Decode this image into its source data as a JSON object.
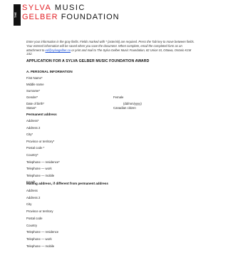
{
  "logo": {
    "side_text": "THE",
    "line1_red": "SYLVA",
    "line1_black": "MUSIC",
    "line2_red": "GELBER",
    "line2_black": "FOUNDATION",
    "line3": ""
  },
  "intro": {
    "text_before_link": "Enter your information in the gray fields. Fields marked with * (asterisk) are required. Press the Tab key to move between fields. Your entered information will be saved when you save the document. When complete, email the completed form as an attachment to ",
    "link": "ed@sylvagelber.ca",
    "text_after_link": " or print and mail to The Sylva Gelber Music Foundation, 82 Union St, Ottawa, Ontario K1M 1S2."
  },
  "title": "APPLICATION FOR A SYLVA GELBER MUSIC FOUNDATION AWARD",
  "personal": {
    "heading": "A. PERSONAL INFORMATION",
    "first_name": "First Name*",
    "middle_name": "Middle name",
    "surname": "Surname*",
    "gender": "Gender*",
    "gender_value": "Female",
    "dob": "Date of birth*",
    "dob_format": "(dd/mm/yyyy)",
    "status": "Status*",
    "status_value": "Canadian citizen"
  },
  "permanent": {
    "heading": "Permanent address",
    "items": [
      "Address*",
      "Address 2",
      "City*",
      "Province or territory*",
      "Postal code *",
      "Country*",
      "Telephone — residence*",
      "Telephone — work",
      "Telephone — mobile",
      "Email*"
    ]
  },
  "mailing": {
    "heading": "Mailing address, if different from permanent address",
    "items": [
      "Address",
      "Address 2",
      "City",
      "Province or territory",
      "Postal code",
      "Country",
      "Telephone — residence",
      "Telephone — work",
      "Telephone — mobile"
    ]
  }
}
